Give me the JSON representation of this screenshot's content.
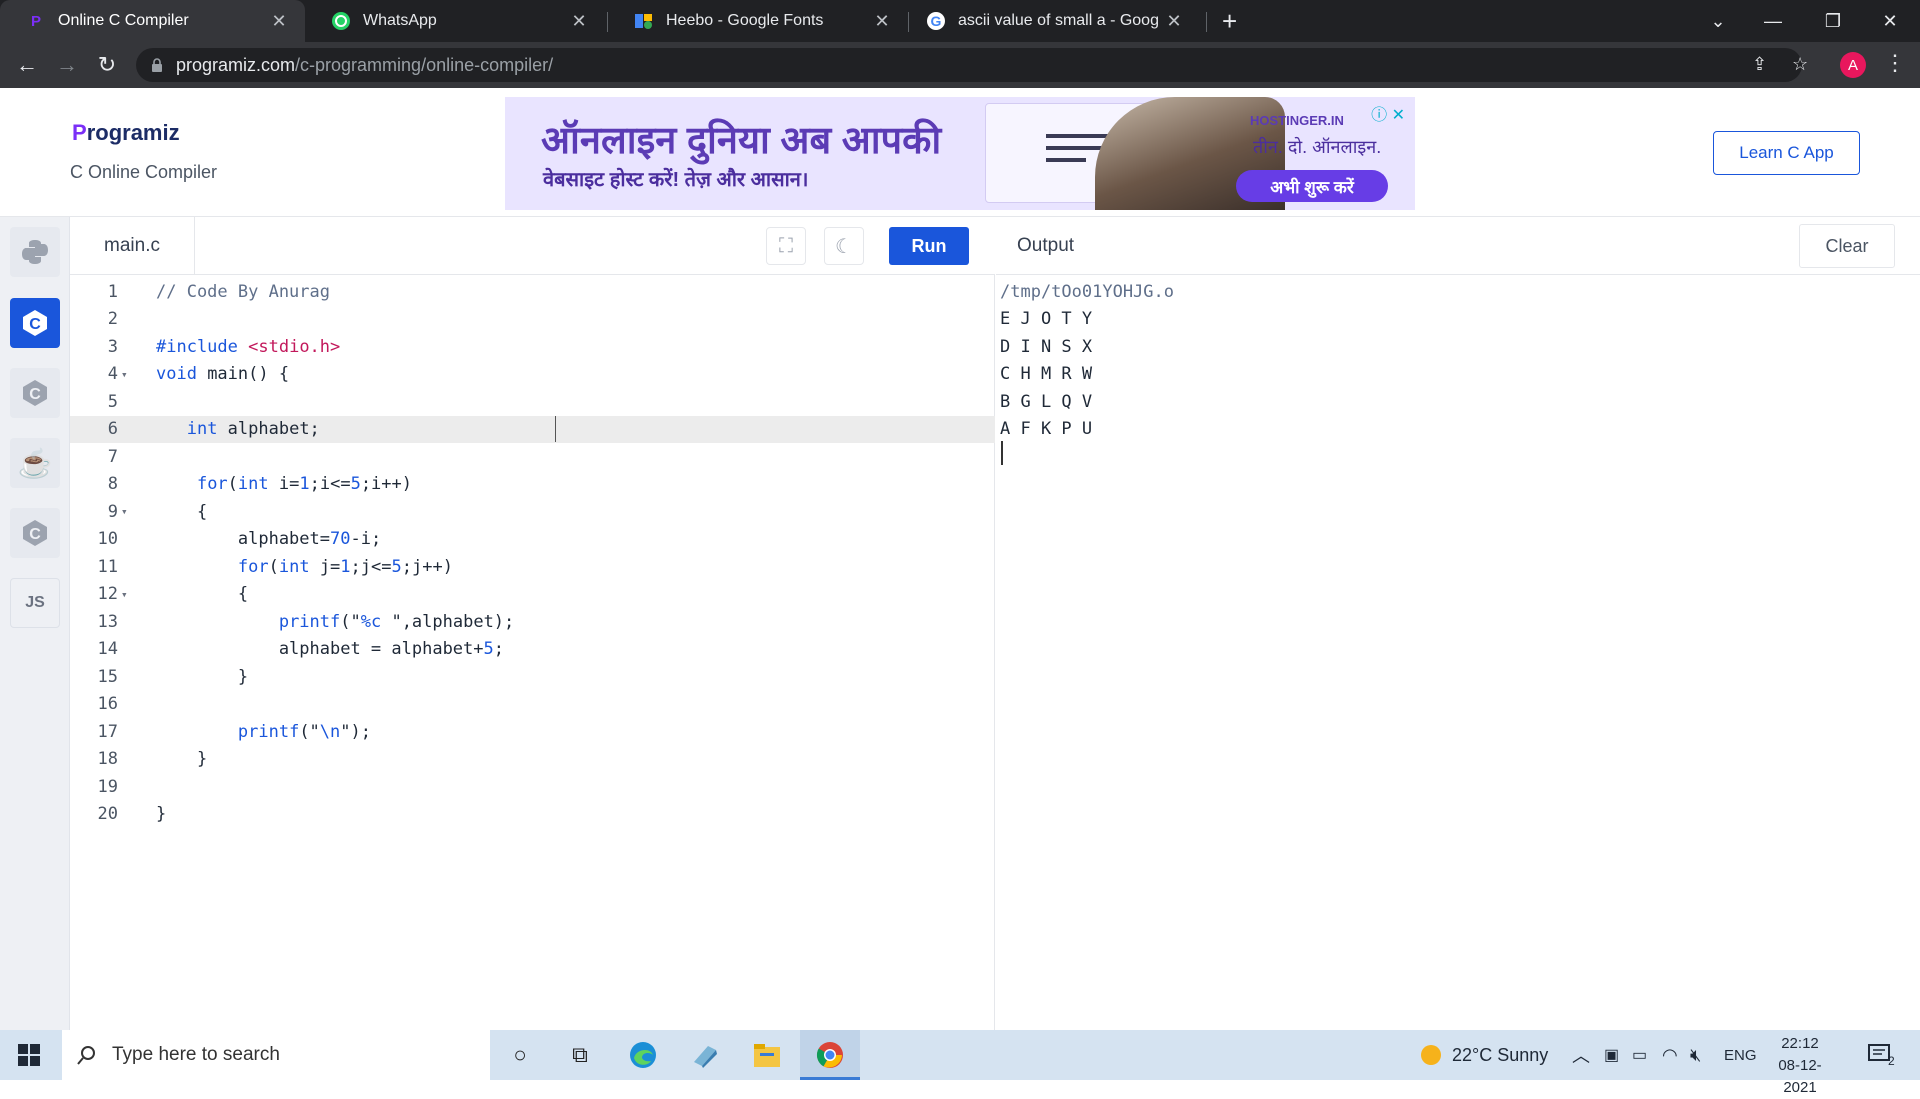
{
  "browser": {
    "tabs": [
      {
        "title": "Online C Compiler",
        "icon": "programiz-icon",
        "active": true
      },
      {
        "title": "WhatsApp",
        "icon": "whatsapp-icon",
        "active": false
      },
      {
        "title": "Heebo - Google Fonts",
        "icon": "google-fonts-icon",
        "active": false
      },
      {
        "title": "ascii value of small a - Google Se",
        "icon": "google-icon",
        "active": false
      }
    ],
    "url_host": "programiz.com",
    "url_path": "/c-programming/online-compiler/",
    "profile_initial": "A"
  },
  "header": {
    "logo": "rogramiz",
    "logo_initial": "P",
    "subtitle": "C Online Compiler",
    "learn_button": "Learn C App"
  },
  "ad": {
    "headline": "ऑनलाइन दुनिया अब आपकी",
    "subline": "वेबसाइट होस्ट करें! तेज़ और आसान।",
    "brand": "HOSTINGER.IN",
    "tagline": "तीन. दो. ऑनलाइन.",
    "cta": "अभी शुरू करें"
  },
  "sidebar": {
    "languages": [
      {
        "name": "python-lang-button",
        "glyph": "🐍"
      },
      {
        "name": "c-lang-button",
        "glyph": "C",
        "active": true
      },
      {
        "name": "cpp-lang-button",
        "glyph": "C"
      },
      {
        "name": "java-lang-button",
        "glyph": "☕"
      },
      {
        "name": "csharp-lang-button",
        "glyph": "C"
      },
      {
        "name": "js-lang-button",
        "glyph": "JS"
      }
    ]
  },
  "editor": {
    "filename": "main.c",
    "run_label": "Run",
    "active_line": 6,
    "lines": [
      {
        "n": "1",
        "html": "<span class=\"cm\">// Code By Anurag</span>"
      },
      {
        "n": "2",
        "html": ""
      },
      {
        "n": "3",
        "html": "<span class=\"kw\">#include</span> <span class=\"str\">&lt;stdio.h&gt;</span>"
      },
      {
        "n": "4",
        "fold": true,
        "html": "<span class=\"kw\">void</span> main() {"
      },
      {
        "n": "5",
        "html": ""
      },
      {
        "n": "6",
        "html": "   <span class=\"kw\">int</span> alphabet;"
      },
      {
        "n": "7",
        "html": ""
      },
      {
        "n": "8",
        "html": "    <span class=\"kw\">for</span>(<span class=\"kw\">int</span> i=<span class=\"kw\">1</span>;i&lt;=<span class=\"kw\">5</span>;i++)"
      },
      {
        "n": "9",
        "fold": true,
        "html": "    {"
      },
      {
        "n": "10",
        "html": "        alphabet=<span class=\"kw\">70</span>-i;"
      },
      {
        "n": "11",
        "html": "        <span class=\"kw\">for</span>(<span class=\"kw\">int</span> j=<span class=\"kw\">1</span>;j&lt;=<span class=\"kw\">5</span>;j++)"
      },
      {
        "n": "12",
        "fold": true,
        "html": "        {"
      },
      {
        "n": "13",
        "html": "            <span class=\"kw\">printf</span>(\"<span class=\"kw\">%c</span> \",alphabet);"
      },
      {
        "n": "14",
        "html": "            alphabet = alphabet+<span class=\"kw\">5</span>;"
      },
      {
        "n": "15",
        "html": "        }"
      },
      {
        "n": "16",
        "html": ""
      },
      {
        "n": "17",
        "html": "        <span class=\"kw\">printf</span>(\"<span class=\"kw\">\\n</span>\");"
      },
      {
        "n": "18",
        "html": "    }"
      },
      {
        "n": "19",
        "html": ""
      },
      {
        "n": "20",
        "html": "}"
      }
    ]
  },
  "output": {
    "title": "Output",
    "clear_label": "Clear",
    "lines": [
      "/tmp/tOo01YOHJG.o",
      "E J O T Y",
      "D I N S X",
      "C H M R W",
      "B G L Q V",
      "A F K P U"
    ]
  },
  "taskbar": {
    "search_placeholder": "Type here to search",
    "weather": "22°C  Sunny",
    "language": "ENG",
    "time": "22:12",
    "date": "08-12-2021",
    "notifications": "2"
  }
}
